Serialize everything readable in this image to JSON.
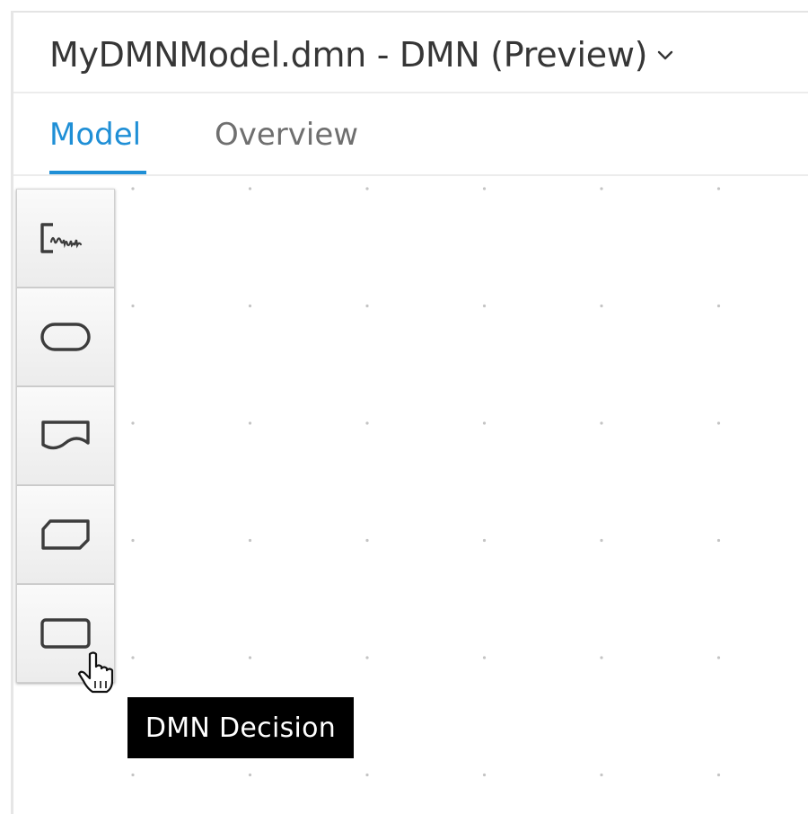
{
  "header": {
    "title": "MyDMNModel.dmn - DMN (Preview)"
  },
  "tabs": [
    {
      "label": "Model",
      "active": true
    },
    {
      "label": "Overview",
      "active": false
    }
  ],
  "colors": {
    "accent": "#1f8fd6",
    "tooltip_bg": "#000000"
  },
  "palette": {
    "items": [
      {
        "icon": "text-annotation-icon"
      },
      {
        "icon": "input-data-icon"
      },
      {
        "icon": "knowledge-source-icon"
      },
      {
        "icon": "business-knowledge-model-icon"
      },
      {
        "icon": "decision-icon"
      }
    ]
  },
  "tooltip": {
    "text": "DMN Decision"
  }
}
